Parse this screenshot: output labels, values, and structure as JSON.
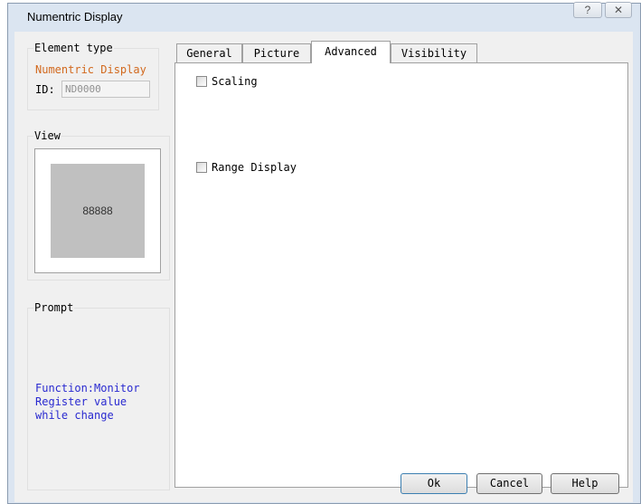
{
  "window": {
    "title": "Numentric Display",
    "help_glyph": "?",
    "close_glyph": "✕"
  },
  "element_type": {
    "group_label": "Element type",
    "type_name": "Numentric Display",
    "id_label": "ID:",
    "id_value": "ND0000"
  },
  "view": {
    "group_label": "View",
    "preview_text": "88888"
  },
  "prompt": {
    "group_label": "Prompt",
    "lines": [
      "Function:Monitor",
      "Register value",
      "while change"
    ]
  },
  "tabs": [
    "General",
    "Picture",
    "Advanced",
    "Visibility"
  ],
  "active_tab": "Advanced",
  "advanced": {
    "scaling_label": "Scaling",
    "scaling_checked": false,
    "range_display_label": "Range Display",
    "range_display_checked": false
  },
  "buttons": {
    "ok": "Ok",
    "cancel": "Cancel",
    "help": "Help"
  },
  "colors": {
    "accent_orange": "#d2691e",
    "prompt_blue": "#2a2ad0",
    "preview_gray": "#c0c0c0"
  }
}
